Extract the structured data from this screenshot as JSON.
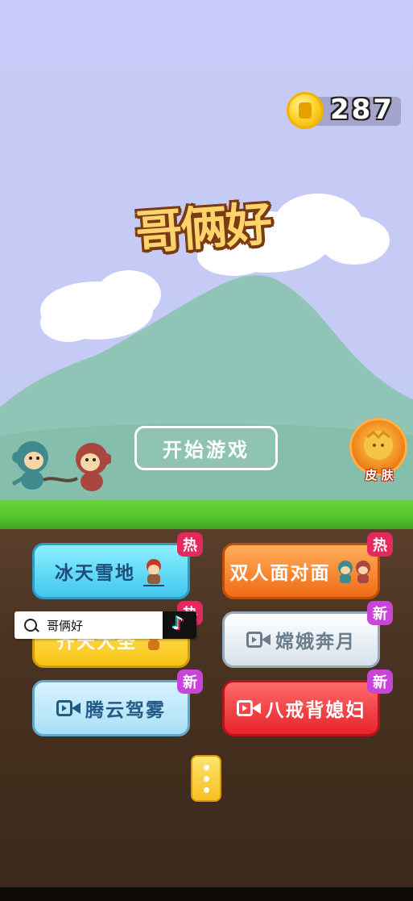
{
  "app": {
    "title": "哥俩好"
  },
  "coins": {
    "value": "287",
    "icon": "gold-coin-icon"
  },
  "main": {
    "start_label": "开始游戏"
  },
  "skin": {
    "label": "皮 肤",
    "icon": "skin-orb-icon"
  },
  "modes": [
    {
      "label": "冰天雪地",
      "tag": "热",
      "color": "#41c6ef",
      "icon": "snow-monkey-icon"
    },
    {
      "label": "双人面对面",
      "tag": "热",
      "color": "#f06b16",
      "icon": "two-monkeys-icon"
    },
    {
      "label": "齐天大圣",
      "tag": "热",
      "color": "#f8c414",
      "icon": "monkey-king-icon"
    },
    {
      "label": "嫦娥奔月",
      "tag": "新",
      "color": "#d7e1ea",
      "icon": "video-icon"
    },
    {
      "label": "腾云驾雾",
      "tag": "新",
      "color": "#a9dff5",
      "icon": "video-icon"
    },
    {
      "label": "八戒背媳妇",
      "tag": "新",
      "color": "#e7242b",
      "icon": "video-icon"
    }
  ],
  "more": {
    "icon": "more-dots-icon"
  },
  "search_overlay": {
    "text": "哥俩好",
    "icon": "search-icon",
    "brand_icon": "tiktok-icon"
  },
  "colors": {
    "tag_hot": "#e3295e",
    "tag_new": "#c845d7",
    "grass": "#52c22d",
    "sky": "#c7cbf7"
  }
}
